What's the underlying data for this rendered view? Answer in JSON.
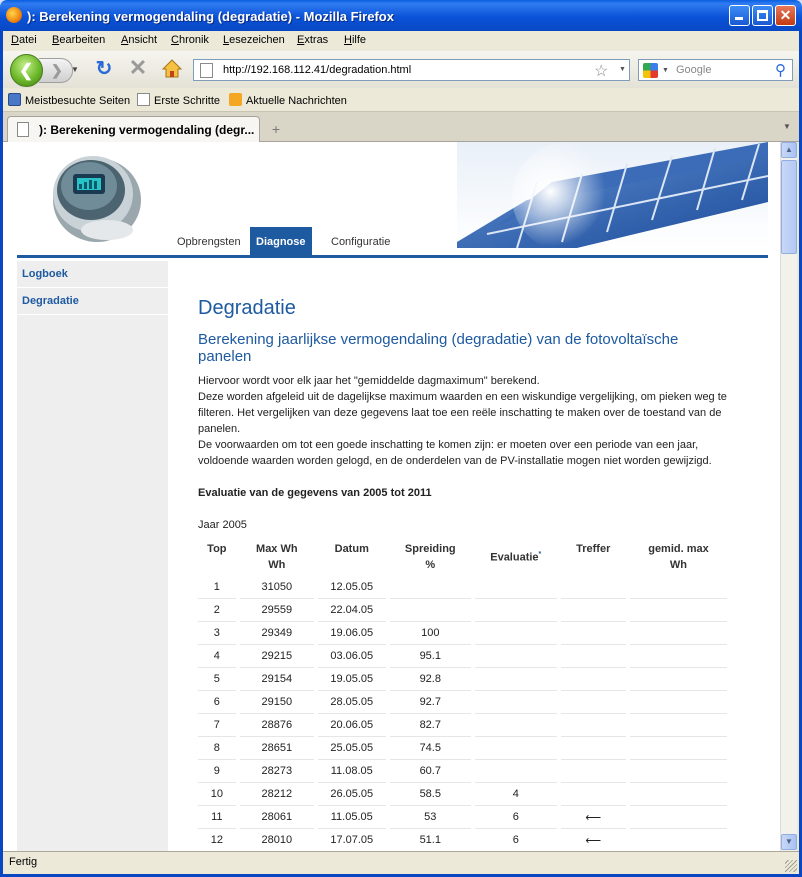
{
  "window": {
    "title": "): Berekening vermogendaling (degradatie) - Mozilla Firefox"
  },
  "menu": [
    "Datei",
    "Bearbeiten",
    "Ansicht",
    "Chronik",
    "Lesezeichen",
    "Extras",
    "Hilfe"
  ],
  "nav": {
    "url": "http://192.168.112.41/degradation.html",
    "search_placeholder": "Google"
  },
  "bookmarks": [
    "Meistbesuchte Seiten",
    "Erste Schritte",
    "Aktuelle Nachrichten"
  ],
  "tab": {
    "label": "): Berekening vermogendaling (degr..."
  },
  "site": {
    "nav": [
      "Opbrengsten",
      "Diagnose",
      "Configuratie"
    ],
    "active_nav": "Diagnose",
    "sidebar": [
      "Logboek",
      "Degradatie"
    ],
    "title": "Degradatie",
    "subtitle": "Berekening jaarlijkse vermogendaling (degradatie) van de fotovoltaïsche panelen",
    "intro": [
      "Hiervoor wordt voor elk jaar het \"gemiddelde dagmaximum\" berekend.",
      "Deze worden afgeleid uit de dagelijkse maximum waarden en een wiskundige vergelijking, om pieken weg te filteren. Het vergelijken van deze gegevens laat toe een reële inschatting te maken over de toestand van de panelen.",
      "De voorwaarden om tot een goede inschatting te komen zijn: er moeten over een periode van een jaar, voldoende waarden worden gelogd, en de onderdelen van de PV-installatie mogen niet worden gewijzigd."
    ],
    "eval_heading": "Evaluatie van de gegevens van 2005 tot 2011",
    "year_label": "Jaar 2005",
    "table": {
      "headers": [
        {
          "line1": "Top",
          "line2": ""
        },
        {
          "line1": "Max Wh",
          "line2": "Wh"
        },
        {
          "line1": "Datum",
          "line2": ""
        },
        {
          "line1": "Spreiding",
          "line2": "%"
        },
        {
          "line1": "Evaluatie",
          "line2": "",
          "sup": "*"
        },
        {
          "line1": "Treffer",
          "line2": ""
        },
        {
          "line1": "gemid. max",
          "line2": "Wh"
        }
      ],
      "rows": [
        [
          "1",
          "31050",
          "12.05.05",
          "",
          "",
          "",
          ""
        ],
        [
          "2",
          "29559",
          "22.04.05",
          "",
          "",
          "",
          ""
        ],
        [
          "3",
          "29349",
          "19.06.05",
          "100",
          "",
          "",
          ""
        ],
        [
          "4",
          "29215",
          "03.06.05",
          "95.1",
          "",
          "",
          ""
        ],
        [
          "5",
          "29154",
          "19.05.05",
          "92.8",
          "",
          "",
          ""
        ],
        [
          "6",
          "29150",
          "28.05.05",
          "92.7",
          "",
          "",
          ""
        ],
        [
          "7",
          "28876",
          "20.06.05",
          "82.7",
          "",
          "",
          ""
        ],
        [
          "8",
          "28651",
          "25.05.05",
          "74.5",
          "",
          "",
          ""
        ],
        [
          "9",
          "28273",
          "11.08.05",
          "60.7",
          "",
          "",
          ""
        ],
        [
          "10",
          "28212",
          "26.05.05",
          "58.5",
          "4",
          "",
          ""
        ],
        [
          "11",
          "28061",
          "11.05.05",
          "53",
          "6",
          "⟵",
          ""
        ],
        [
          "12",
          "28010",
          "17.07.05",
          "51.1",
          "6",
          "⟵",
          ""
        ]
      ]
    }
  },
  "status": "Fertig",
  "colors": {
    "accent": "#1e5aa0",
    "titlebar": "#0a52d8"
  }
}
